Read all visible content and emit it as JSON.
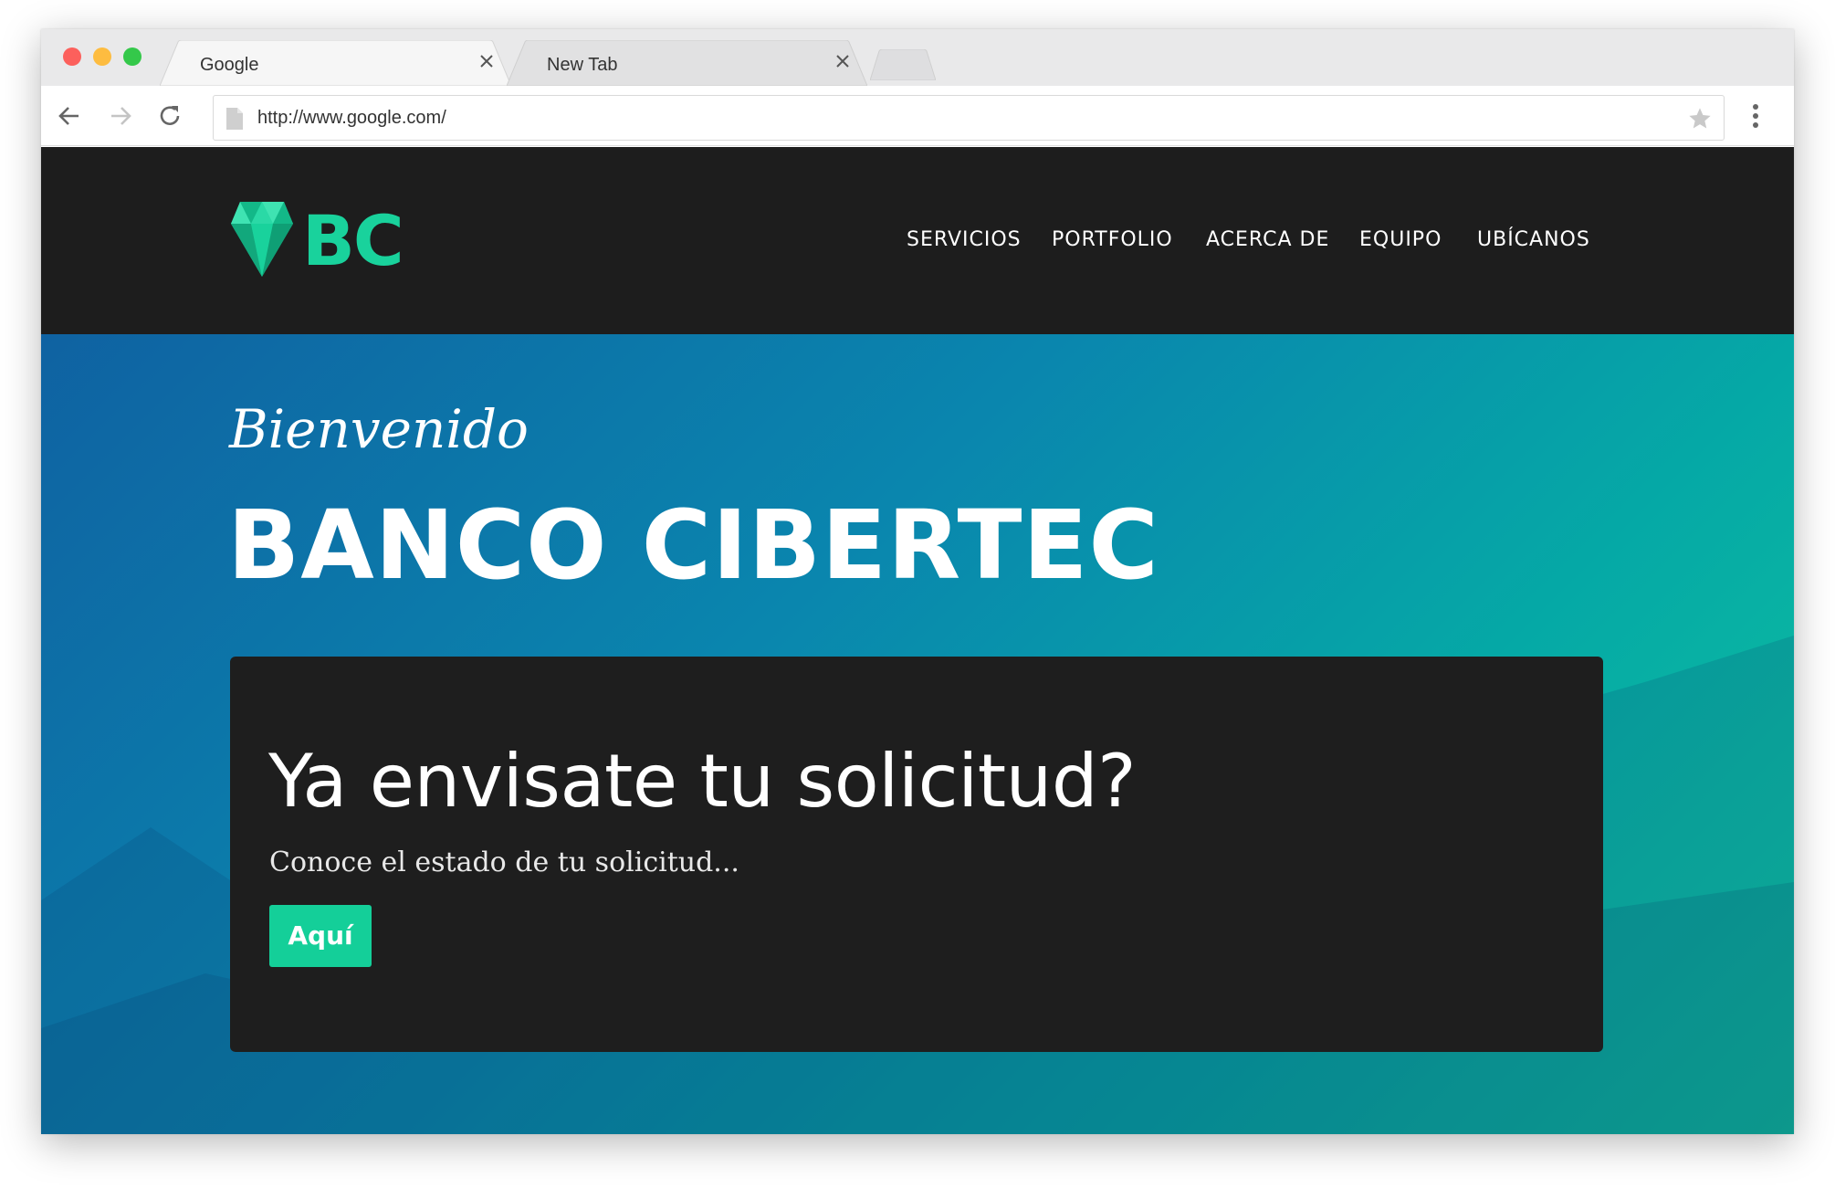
{
  "browser": {
    "tabs": [
      {
        "title": "Google",
        "active": true
      },
      {
        "title": "New Tab",
        "active": false
      }
    ],
    "url": "http://www.google.com/",
    "colors": {
      "close": "#fc605c",
      "minimize": "#fdbc40",
      "zoom": "#34c84a"
    }
  },
  "site": {
    "logo_text": "BC",
    "nav": [
      "SERVICIOS",
      "PORTFOLIO",
      "ACERCA DE",
      "EQUIPO",
      "UBÍCANOS"
    ],
    "colors": {
      "accent": "#19d29c",
      "header_bg": "#1d1d1d",
      "card_bg": "#1e1e1e"
    }
  },
  "hero": {
    "welcome": "Bienvenido",
    "title": "BANCO CIBERTEC"
  },
  "card": {
    "heading": "Ya envisate tu solicitud?",
    "text": "Conoce el estado de tu solicitud...",
    "button_label": "Aquí"
  }
}
